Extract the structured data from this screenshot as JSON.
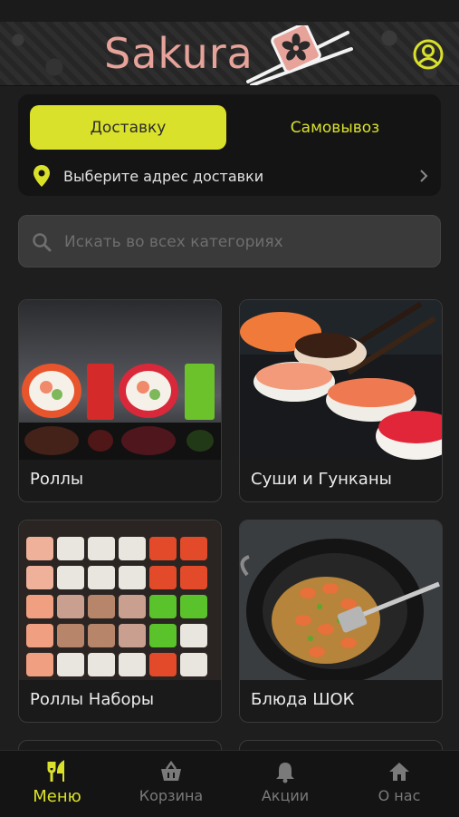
{
  "app": {
    "title": "Sakura"
  },
  "delivery": {
    "tab_delivery": "Доставку",
    "tab_pickup": "Самовывоз",
    "address_prompt": "Выберите адрес доставки"
  },
  "search": {
    "placeholder": "Искать во всех категориях"
  },
  "categories": [
    {
      "label": "Роллы"
    },
    {
      "label": "Суши и Гунканы"
    },
    {
      "label": "Роллы Наборы"
    },
    {
      "label": "Блюда ШОК"
    }
  ],
  "tabbar": [
    {
      "label": "Меню",
      "icon": "fork-knife-icon",
      "active": true
    },
    {
      "label": "Корзина",
      "icon": "basket-icon",
      "active": false
    },
    {
      "label": "Акции",
      "icon": "bell-icon",
      "active": false
    },
    {
      "label": "О нас",
      "icon": "home-icon",
      "active": false
    }
  ],
  "colors": {
    "accent": "#d9e12a",
    "logo": "#e7a39a",
    "background": "#1e1e1f"
  }
}
